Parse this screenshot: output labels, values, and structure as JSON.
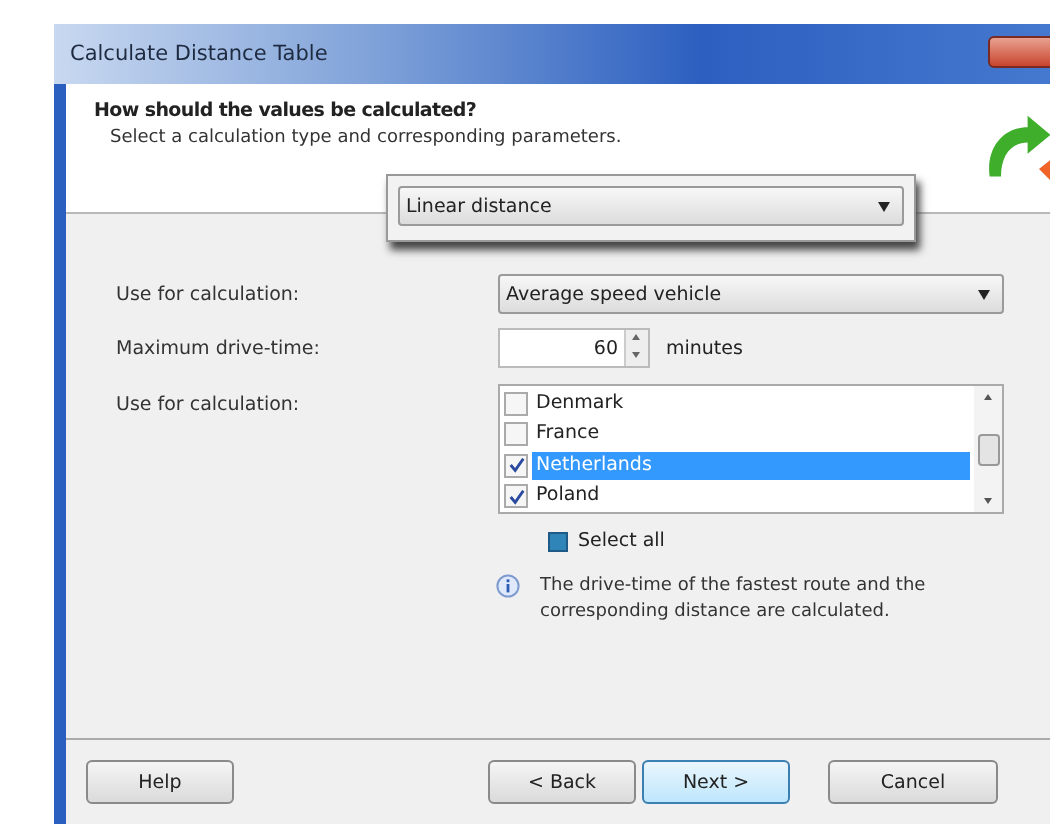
{
  "window": {
    "title": "Calculate Distance Table"
  },
  "header": {
    "title": "How should the values be calculated?",
    "subtitle": "Select a calculation type and corresponding parameters."
  },
  "type_dropdown": {
    "value": "Linear distance"
  },
  "fields": [
    {
      "kind": "select",
      "label": "Use for calculation:",
      "value": "Average speed vehicle"
    },
    {
      "kind": "spin",
      "label": "Maximum drive-time:",
      "value": "60",
      "unit": "minutes"
    },
    {
      "kind": "checklist",
      "label": "Use for calculation:",
      "items": [
        {
          "label": "Denmark",
          "checked": false,
          "selected": false
        },
        {
          "label": "France",
          "checked": false,
          "selected": false
        },
        {
          "label": "Netherlands",
          "checked": true,
          "selected": true
        },
        {
          "label": "Poland",
          "checked": true,
          "selected": false
        }
      ]
    }
  ],
  "select_all": {
    "label": "Select all",
    "mixed": true
  },
  "info": "The drive-time of the fastest route and the corresponding distance are calculated.",
  "buttons": [
    {
      "label": "Help",
      "kind": "help",
      "default": false
    },
    {
      "label": "< Back",
      "kind": "nav",
      "default": false
    },
    {
      "label": "Next >",
      "kind": "nav",
      "default": true
    },
    {
      "label": "Cancel",
      "kind": "cancel",
      "default": false
    }
  ]
}
